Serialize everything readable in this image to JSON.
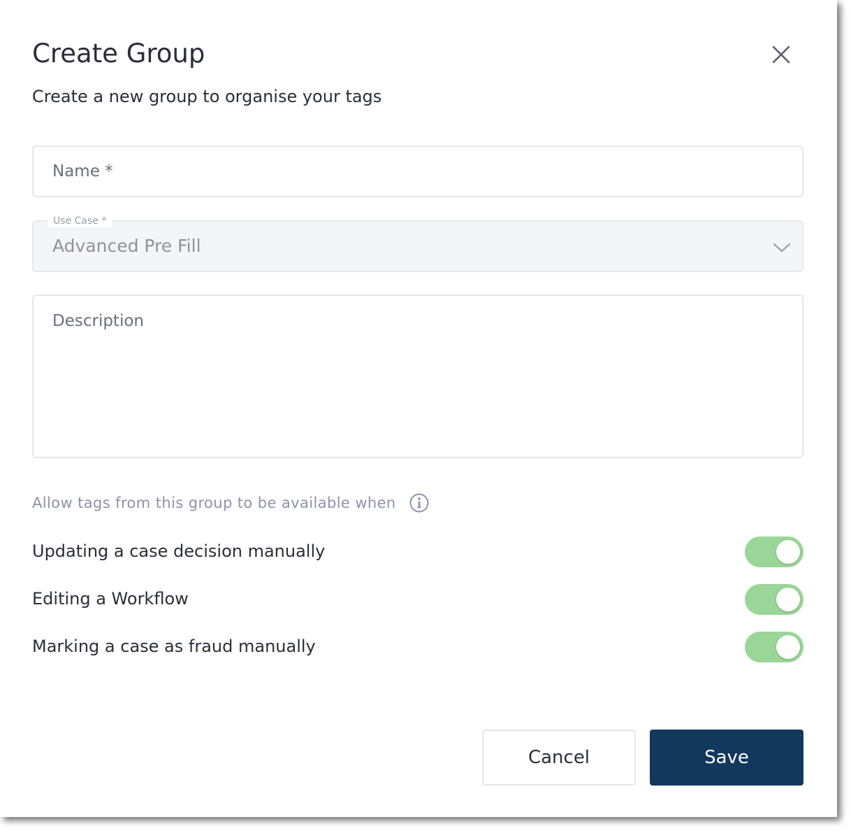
{
  "dialog": {
    "title": "Create Group",
    "subtitle": "Create a new group to organise your tags",
    "close_icon": "close-icon"
  },
  "form": {
    "name_placeholder": "Name *",
    "use_case_label": "Use Case *",
    "use_case_value": "Advanced Pre Fill",
    "description_placeholder": "Description"
  },
  "availability": {
    "heading": "Allow tags from this group to be available when",
    "info_icon": "info-icon",
    "toggles": [
      {
        "label": "Updating a case decision manually",
        "on": true
      },
      {
        "label": "Editing a Workflow",
        "on": true
      },
      {
        "label": "Marking a case as fraud manually",
        "on": true
      }
    ]
  },
  "actions": {
    "cancel_label": "Cancel",
    "save_label": "Save"
  },
  "colors": {
    "primary": "#12385c",
    "toggle_on": "#9ad697",
    "text": "#2b2d3a",
    "muted": "#8d93ab"
  }
}
